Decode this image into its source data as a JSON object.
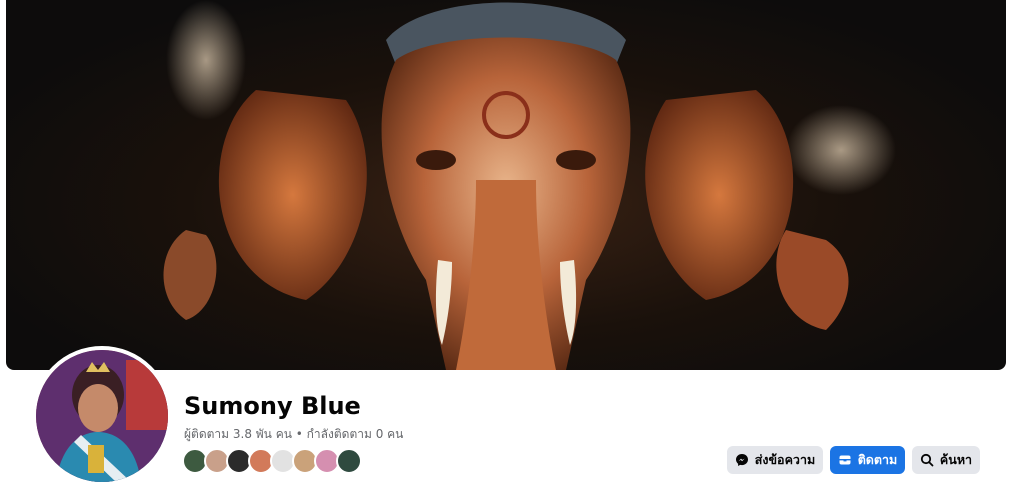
{
  "profile": {
    "name": "Sumony Blue",
    "stats": "ผู้ติดตาม 3.8 พัน คน • กำลังติดตาม 0 คน"
  },
  "actions": {
    "message_label": "ส่งข้อความ",
    "follow_label": "ติดตาม",
    "search_label": "ค้นหา"
  },
  "colors": {
    "accent": "#1b74e4",
    "secondary_button": "#e4e6eb",
    "muted_text": "#65676b"
  },
  "friend_avatar_colors": [
    "#3d5a40",
    "#c9a08a",
    "#2b2b2b",
    "#d27a5a",
    "#e2e2e2",
    "#caa27a",
    "#d58fb0",
    "#2f4a3f"
  ]
}
